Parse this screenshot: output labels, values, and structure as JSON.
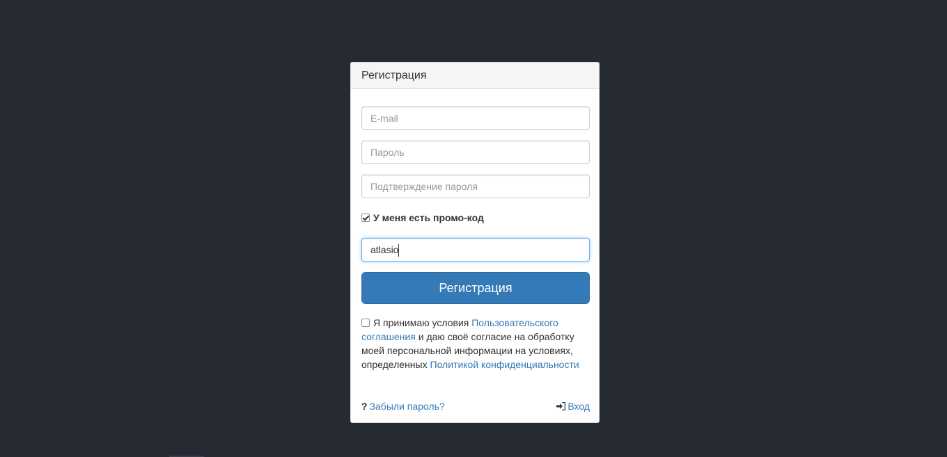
{
  "panel": {
    "title": "Регистрация"
  },
  "form": {
    "email_placeholder": "E-mail",
    "password_placeholder": "Пароль",
    "confirm_placeholder": "Подтверждение пароля",
    "promo_checkbox_label": "У меня есть промо-код",
    "promo_checked": true,
    "promo_value": "atlasio",
    "submit_label": "Регистрация"
  },
  "terms": {
    "checked": false,
    "text_1": "Я принимаю условия ",
    "link_1": "Пользовательского соглашения",
    "text_2": " и даю своё согласие на обработку моей персональной информации на условиях, определенных ",
    "link_2": "Политикой конфиденциальности"
  },
  "footer": {
    "forgot_icon": "question-icon",
    "forgot_label": "Забыли пароль?",
    "login_icon": "sign-in-icon",
    "login_label": "Вход"
  },
  "colors": {
    "background": "#262a33",
    "primary": "#337ab7",
    "focus": "#66afe9"
  }
}
